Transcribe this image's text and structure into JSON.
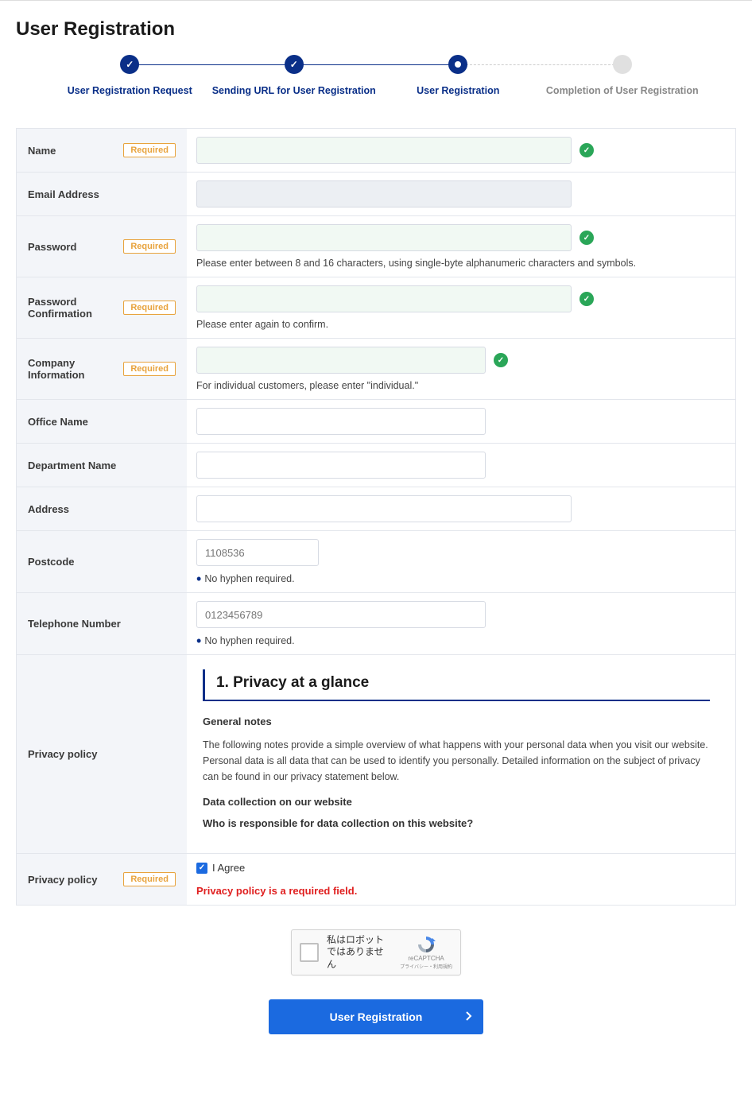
{
  "page_title": "User Registration",
  "steps": [
    {
      "label": "User Registration Request",
      "status": "done"
    },
    {
      "label": "Sending URL for User Registration",
      "status": "done"
    },
    {
      "label": "User Registration",
      "status": "active"
    },
    {
      "label": "Completion of User Registration",
      "status": "future"
    }
  ],
  "required_label": "Required",
  "fields": {
    "name": {
      "label": "Name",
      "required": true,
      "valid": true
    },
    "email": {
      "label": "Email Address",
      "required": false,
      "readonly": true
    },
    "password": {
      "label": "Password",
      "required": true,
      "valid": true,
      "helper": "Please enter between 8 and 16 characters, using single-byte alphanumeric characters and symbols."
    },
    "password_confirm": {
      "label": "Password Confirmation",
      "required": true,
      "valid": true,
      "helper": "Please enter again to confirm."
    },
    "company": {
      "label": "Company Information",
      "required": true,
      "valid": true,
      "helper": "For individual customers, please enter \"individual.\""
    },
    "office": {
      "label": "Office Name"
    },
    "department": {
      "label": "Department Name"
    },
    "address": {
      "label": "Address"
    },
    "postcode": {
      "label": "Postcode",
      "placeholder": "1108536",
      "helper": "No hyphen required."
    },
    "phone": {
      "label": "Telephone Number",
      "placeholder": "0123456789",
      "helper": "No hyphen required."
    },
    "privacy_view": {
      "label": "Privacy policy"
    },
    "privacy_agree": {
      "label": "Privacy policy",
      "required": true,
      "agree_label": "I Agree",
      "error": "Privacy policy is a required field."
    }
  },
  "privacy_content": {
    "heading": "1.  Privacy at a glance",
    "sub1": "General notes",
    "text1": "The following notes provide a simple overview of what happens with your personal data when you visit our website. Personal data is all data that can be used to identify you personally. Detailed information on the subject of privacy can be found in our privacy statement below.",
    "sub2": "Data collection on our website",
    "sub3": "Who is responsible for data collection on this website?"
  },
  "recaptcha": {
    "text": "私はロボットではありません",
    "brand": "reCAPTCHA",
    "terms": "プライバシー・利用規約"
  },
  "submit_label": "User Registration"
}
